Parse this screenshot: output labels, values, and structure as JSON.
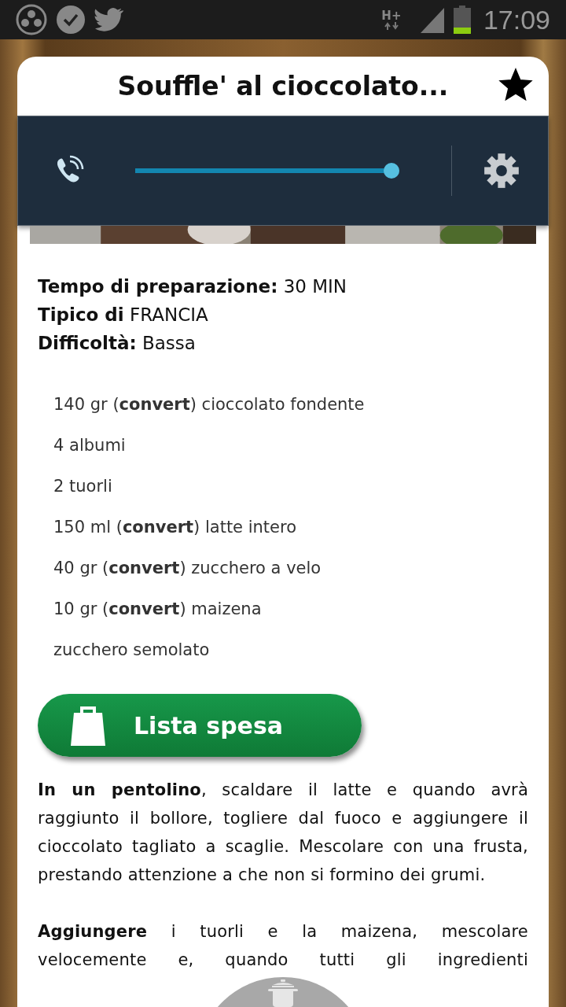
{
  "status_bar": {
    "network": "H+",
    "time": "17:09"
  },
  "title": "Souffle' al cioccolato...",
  "favorite": true,
  "volume": {
    "level": 1
  },
  "info": [
    {
      "label": "Tempo di preparazione:",
      "value": "30 MIN"
    },
    {
      "label": "Tipico di",
      "value": "FRANCIA"
    },
    {
      "label": "Difficoltà:",
      "value": "Bassa"
    }
  ],
  "ingredients": [
    "140 gr (**convert**) cioccolato fondente",
    "4 albumi",
    "2 tuorli",
    "150 ml (**convert**) latte intero",
    "40 gr (**convert**) zucchero a velo",
    "10 gr (**convert**) maizena",
    "zucchero semolato"
  ],
  "shopping_button": "Lista spesa",
  "steps": [
    "**In un pentolino**, scaldare il latte e quando avrà raggiunto il bollore, togliere dal fuoco e aggiungere il cioccolato tagliato a scaglie. Mescolare con una frusta, prestando attenzione a che non si formino dei grumi.",
    "**Aggiungere** i tuorli e la maizena, mescolare velocemente e, quando tutti gli ingredienti"
  ]
}
